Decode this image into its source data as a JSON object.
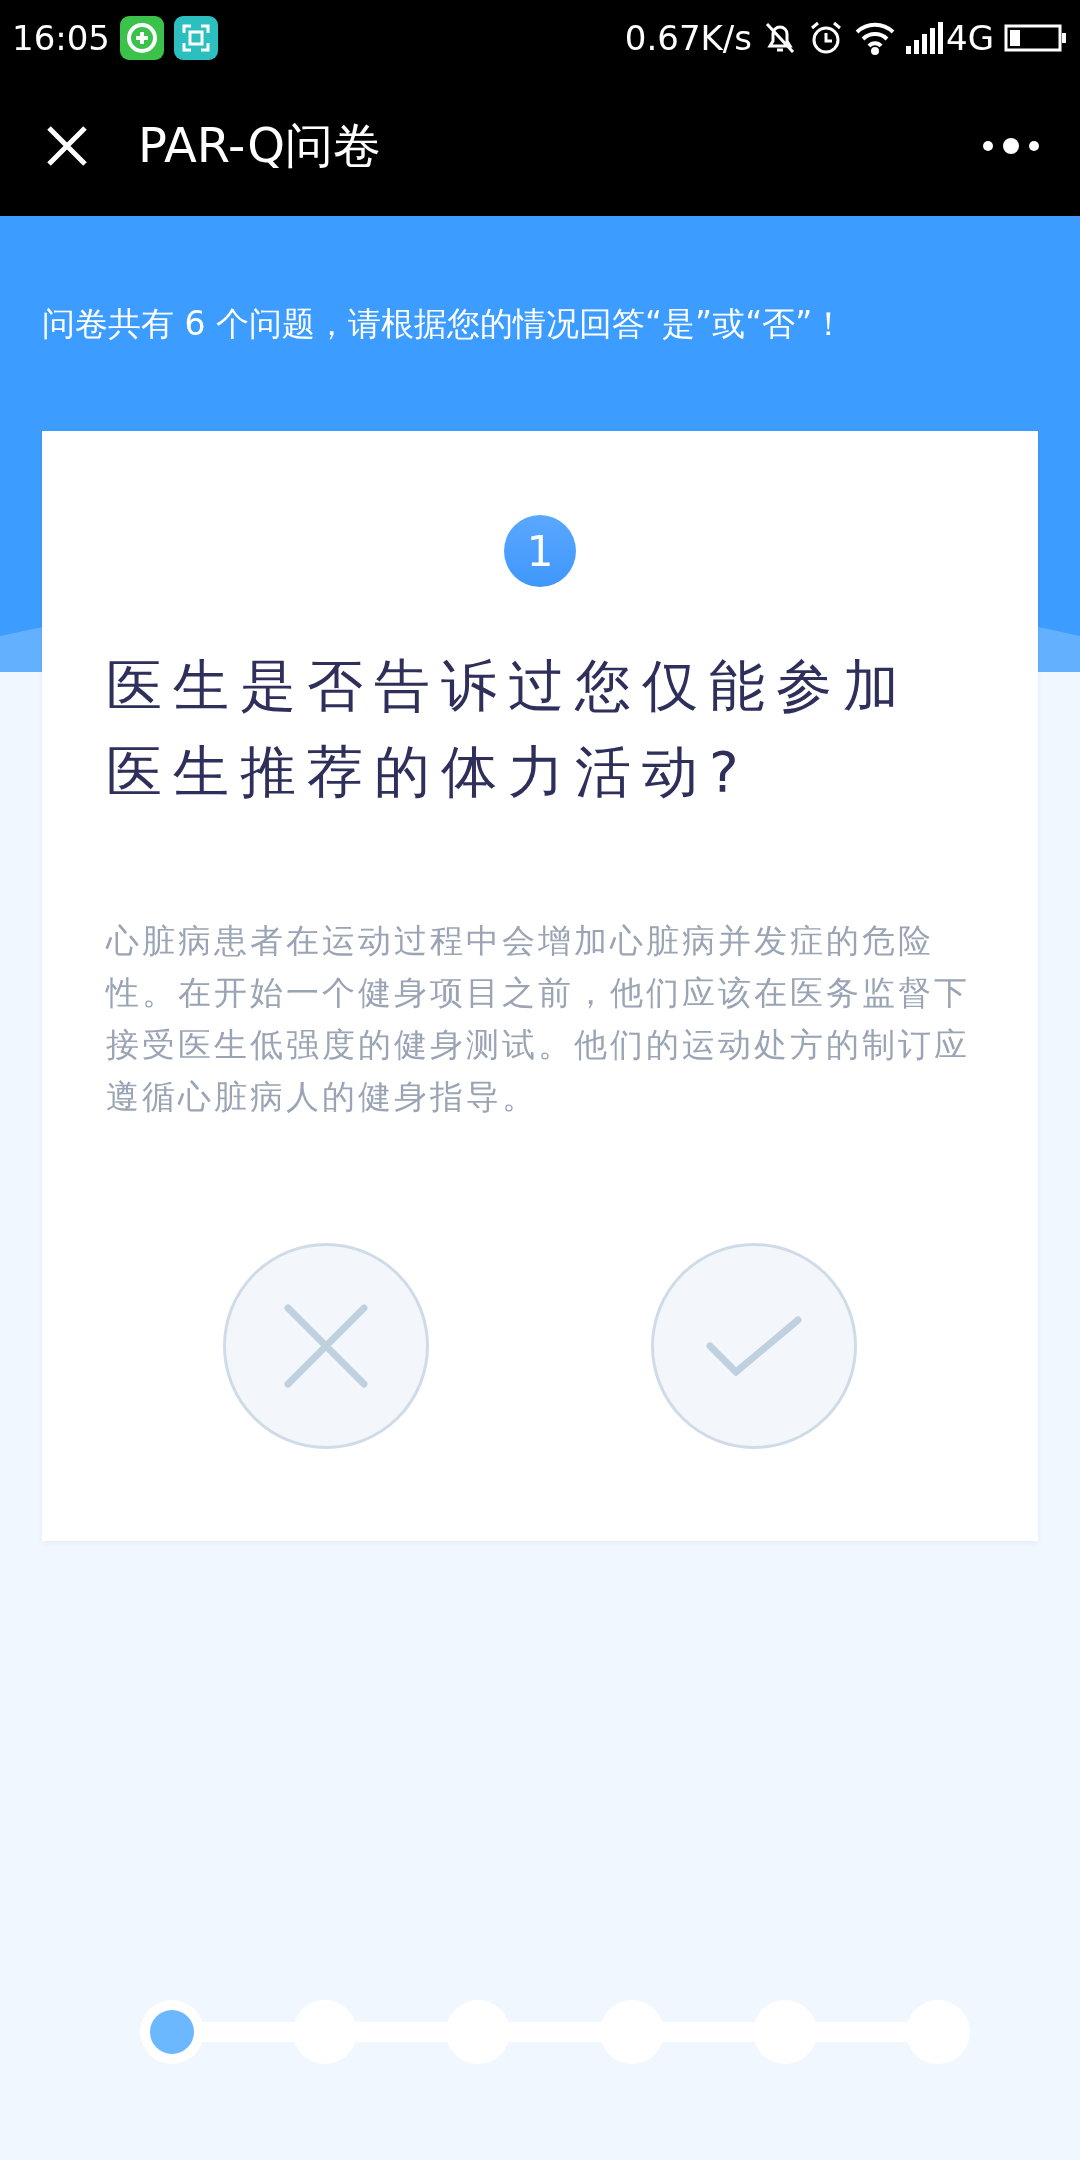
{
  "status_bar": {
    "time": "16:05",
    "net_speed": "0.67K/s",
    "network": "4G"
  },
  "header": {
    "title": "PAR-Q问卷"
  },
  "intro": "问卷共有 6 个问题，请根据您的情况回答“是”或“否”！",
  "question": {
    "number": "1",
    "title": "医生是否告诉过您仅能参加医生推荐的体力活动?",
    "description": "心脏病患者在运动过程中会增加心脏病并发症的危险性。在开始一个健身项目之前，他们应该在医务监督下接受医生低强度的健身测试。他们的运动处方的制订应遵循心脏病人的健身指导。"
  },
  "answers": [
    {
      "kind": "no"
    },
    {
      "kind": "yes"
    }
  ],
  "steps": [
    {
      "selected": true
    },
    {
      "selected": false
    },
    {
      "selected": false
    },
    {
      "selected": false
    },
    {
      "selected": false
    },
    {
      "selected": false
    }
  ]
}
